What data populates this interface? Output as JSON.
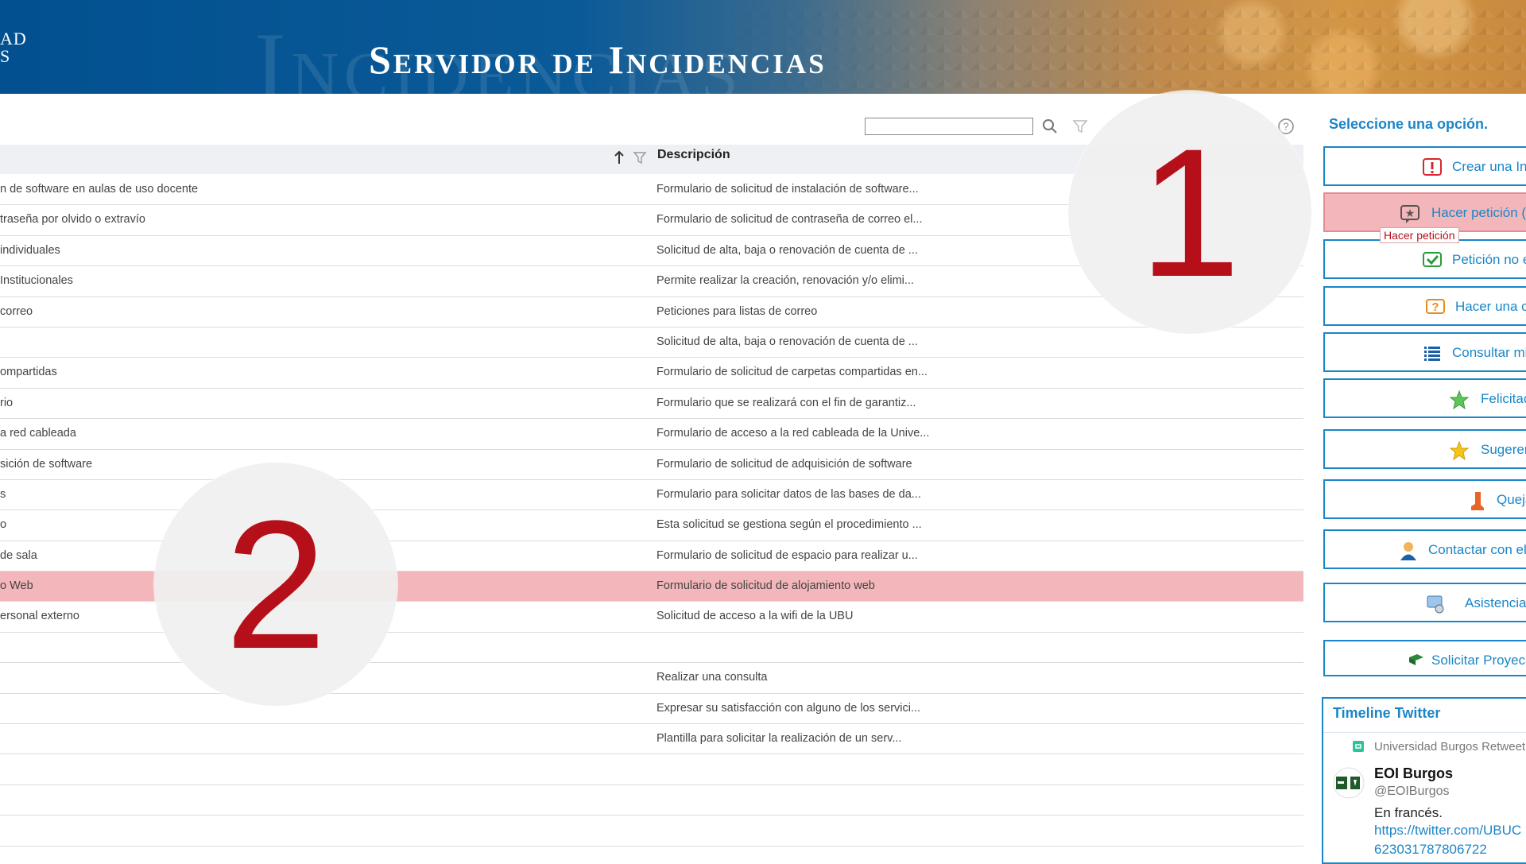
{
  "banner": {
    "title": "Servidor de Incidencias",
    "ghost_text": "Incidencias",
    "logo_line1": "AD",
    "logo_line2": "S"
  },
  "toolbar": {
    "search_placeholder": "",
    "icons": [
      "search-icon",
      "filter-icon",
      "help-icon"
    ]
  },
  "table": {
    "col_description": "Descripción",
    "rows": [
      {
        "name": "n de software en aulas de uso docente",
        "desc": "Formulario de solicitud de instalación de software..."
      },
      {
        "name": "traseña por olvido o extravío",
        "desc": "Formulario de solicitud de contraseña de correo el..."
      },
      {
        "name": "individuales",
        "desc": "Solicitud de alta, baja o renovación de cuenta de ..."
      },
      {
        "name": "Institucionales",
        "desc": "Permite realizar la creación, renovación y/o elimi..."
      },
      {
        "name": "correo",
        "desc": "Peticiones para listas de correo"
      },
      {
        "name": "",
        "desc": "Solicitud de alta, baja o renovación de cuenta de ..."
      },
      {
        "name": "ompartidas",
        "desc": "Formulario de solicitud de carpetas compartidas en..."
      },
      {
        "name": "rio",
        "desc": "Formulario que se realizará con el fin de garantiz..."
      },
      {
        "name": "a red cableada",
        "desc": "Formulario de acceso a la red cableada de la Unive..."
      },
      {
        "name": "sición de software",
        "desc": "Formulario de solicitud de adquisición de software"
      },
      {
        "name": "s",
        "desc": "Formulario para solicitar datos de las bases de da..."
      },
      {
        "name": "o",
        "desc": "Esta solicitud se gestiona según el procedimiento ..."
      },
      {
        "name": "de sala",
        "desc": "Formulario de solicitud de espacio para realizar u..."
      },
      {
        "name": "o Web",
        "desc": "Formulario de solicitud de alojamiento web",
        "selected": true
      },
      {
        "name": "ersonal externo",
        "desc": "Solicitud de acceso a la wifi de la UBU"
      },
      {
        "name": "",
        "desc": ""
      },
      {
        "name": "",
        "desc": "Realizar una consulta"
      },
      {
        "name": "",
        "desc": "Expresar su satisfacción con alguno de los servici..."
      },
      {
        "name": "",
        "desc": "Plantilla para solicitar la realización de un serv..."
      },
      {
        "name": "",
        "desc": ""
      },
      {
        "name": "",
        "desc": ""
      },
      {
        "name": "",
        "desc": ""
      }
    ]
  },
  "markers": {
    "one": "1",
    "two": "2"
  },
  "sidebar": {
    "title": "Seleccione una opción.",
    "options": [
      {
        "label": "Crear una In",
        "icon": "exclamation-icon"
      },
      {
        "label": "Hacer petición (",
        "icon": "star-request-icon",
        "highlight": true
      },
      {
        "label": "Petición no e",
        "icon": "check-icon"
      },
      {
        "label": "Hacer una c",
        "icon": "question-icon"
      },
      {
        "label": "Consultar mi",
        "icon": "list-icon"
      },
      {
        "label": "Felicitac",
        "icon": "green-star-icon"
      },
      {
        "label": "Sugeren",
        "icon": "yellow-star-icon"
      },
      {
        "label": "Queja",
        "icon": "boot-icon"
      },
      {
        "label": "Contactar con el",
        "icon": "person-icon"
      },
      {
        "label": "Asistencia",
        "icon": "computer-icon"
      },
      {
        "label": "Solicitar Proyec",
        "icon": "book-icon"
      }
    ],
    "tooltip": "Hacer petición"
  },
  "twitter": {
    "title": "Timeline Twitter",
    "retweet": "Universidad Burgos Retweet",
    "name": "EOI Burgos",
    "handle": "@EOIBurgos",
    "text": "En francés.",
    "link1": "https://twitter.com/UBUC",
    "link2": "623031787806722"
  },
  "colors": {
    "accent": "#1a86c8",
    "selected_row": "#f3b6ba",
    "marker_red": "#b5101a"
  }
}
